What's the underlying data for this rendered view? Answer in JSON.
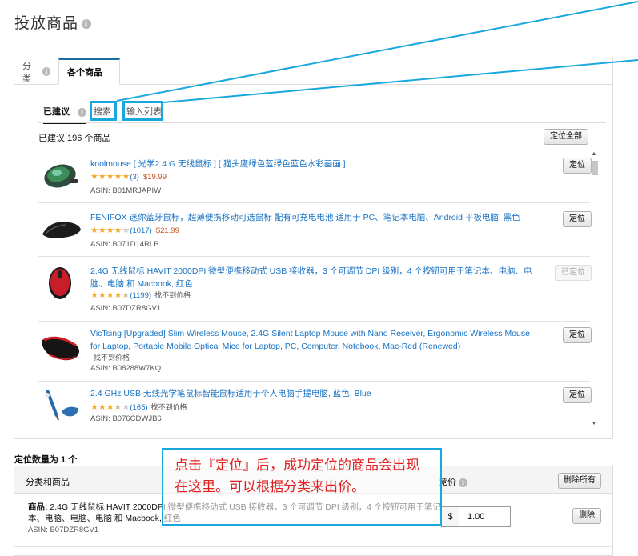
{
  "page": {
    "title": "投放商品"
  },
  "tabs": {
    "category": "分类",
    "individual": "各个商品"
  },
  "subtabs": {
    "suggested": "已建议",
    "search": "搜索",
    "input_list": "输入列表"
  },
  "suggested": {
    "count_text": "已建议 196 个商品",
    "locate_all": "定位全部"
  },
  "products": [
    {
      "title": "koolmouse [ 光学2.4 G 无线鼠标 ] [ 猫头鹰绿色蓝绿色蓝色水彩画画 ]",
      "rating": 5,
      "reviews": "(3)",
      "price": "$19.99",
      "asin": "ASIN: B01MRJAPIW",
      "button": "定位",
      "disabled": false
    },
    {
      "title": "FENIFOX 迷你蓝牙鼠标，超薄便携移动可选鼠标 配有可充电电池 适用于 PC、笔记本电脑、Android 平板电脑, 黑色",
      "rating": 4,
      "reviews": "(1017)",
      "price": "$21.99",
      "asin": "ASIN: B071D14RLB",
      "button": "定位",
      "disabled": false
    },
    {
      "title": "2.4G 无线鼠标 HAVIT 2000DPI 微型便携移动式 USB 接收器，3 个可调节 DPI 级别，4 个按钮可用于笔记本、电脑、电脑、电脑 和 Macbook, 红色",
      "rating": 4.5,
      "reviews": "(1199)",
      "price": "找不到价格",
      "asin": "ASIN: B07DZR8GV1",
      "button": "已定位",
      "disabled": true
    },
    {
      "title": "VicTsing [Upgraded] Slim Wireless Mouse, 2.4G Silent Laptop Mouse with Nano Receiver, Ergonomic Wireless Mouse for Laptop, Portable Mobile Optical Mice for Laptop, PC, Computer, Notebook, Mac-Red (Renewed)",
      "price": "找不到价格",
      "asin": "ASIN: B08288W7KQ",
      "button": "定位",
      "disabled": false
    },
    {
      "title": "2.4 GHz USB 无线光学笔鼠标智能鼠标适用于个人电脑手提电脑, 蓝色, Blue",
      "rating": 3.5,
      "reviews": "(165)",
      "price": "找不到价格",
      "asin": "ASIN: B076CDWJB6",
      "button": "定位",
      "disabled": false
    }
  ],
  "targeted": {
    "count_text": "定位数量为 1 个",
    "cat_header": "分类和商品",
    "bid_header": "竞价",
    "remove_all": "删除所有",
    "row": {
      "label": "商品:",
      "text": "2.4G 无线鼠标 HAVIT 2000DPI 微型便携移动式 USB 接收器，3 个可调节 DPI 级别，4 个按钮可用于笔记本、电脑、电脑、电脑 和 Macbook, 红色",
      "asin": "ASIN: B07DZR8GV1",
      "currency": "$",
      "bid": "1.00",
      "remove": "删除"
    }
  },
  "annotation": {
    "text": "点击『定位』后，成功定位的商品会出现在这里。可以根据分类来出价。"
  },
  "colors": {
    "link": "#1772c4",
    "price": "#c7511f",
    "highlight": "#18a7de",
    "annotation_text": "#e0201f",
    "tab_accent": "#1a6e9e"
  }
}
